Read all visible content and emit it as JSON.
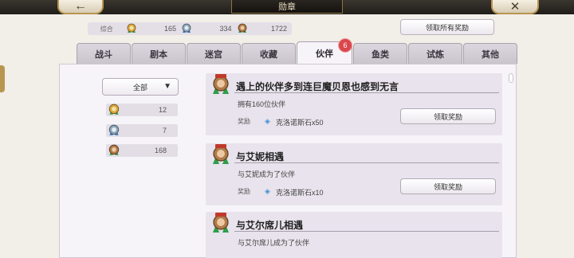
{
  "window": {
    "title": "勋章",
    "back_glyph": "←",
    "close_glyph": "✕"
  },
  "summary": {
    "label": "综合",
    "gold_count": "165",
    "silver_count": "334",
    "bronze_count": "1722"
  },
  "claim_all_label": "领取所有奖励",
  "tabs": [
    {
      "label": "战斗",
      "active": false
    },
    {
      "label": "剧本",
      "active": false
    },
    {
      "label": "迷宫",
      "active": false
    },
    {
      "label": "收藏",
      "active": false
    },
    {
      "label": "伙伴",
      "active": true
    },
    {
      "label": "鱼类",
      "active": false
    },
    {
      "label": "试炼",
      "active": false
    },
    {
      "label": "其他",
      "active": false
    }
  ],
  "tab_badge": "6",
  "filter": {
    "selected": "全部"
  },
  "stats": [
    {
      "medal": "gold-medal-icon",
      "count": "12"
    },
    {
      "medal": "silver-medal-icon",
      "count": "7"
    },
    {
      "medal": "bronze-medal-icon",
      "count": "168"
    }
  ],
  "achievements": [
    {
      "title": "遇上的伙伴多到连巨魔贝恩也感到无言",
      "desc": "拥有160位伙伴",
      "reward_label": "奖励",
      "reward": "克洛诺斯石x50",
      "claim_label": "领取奖励"
    },
    {
      "title": "与艾妮相遇",
      "desc": "与艾妮成为了伙伴",
      "reward_label": "奖励",
      "reward": "克洛诺斯石x10",
      "claim_label": "领取奖励"
    },
    {
      "title": "与艾尔席儿相遇",
      "desc": "与艾尔席儿成为了伙伴",
      "reward_label": "",
      "reward": "",
      "claim_label": ""
    }
  ],
  "colors": {
    "gold": "#d8a93a",
    "silver": "#8ea7b8",
    "bronze": "#b07a4a",
    "badge": "#d9474d",
    "crystal": "#3d8fd6"
  }
}
